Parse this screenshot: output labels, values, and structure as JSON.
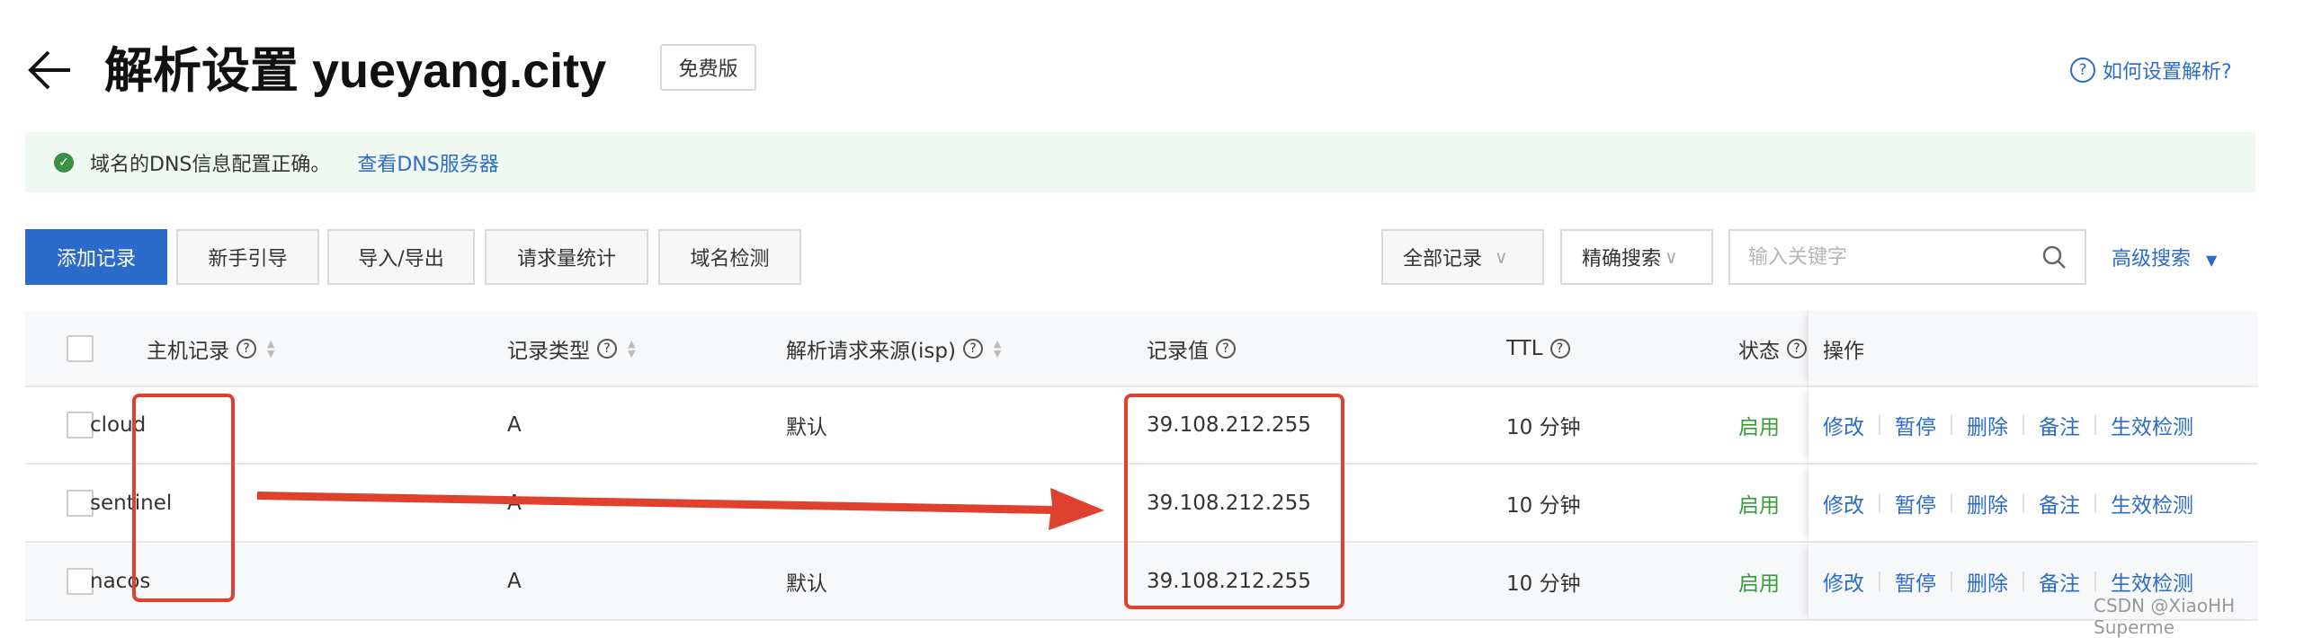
{
  "header": {
    "title": "解析设置 yueyang.city",
    "badge": "免费版",
    "help_link": "如何设置解析?",
    "help_icon": "question-circle-icon",
    "back_icon": "arrow-left-icon"
  },
  "notice": {
    "text": "域名的DNS信息配置正确。",
    "link": "查看DNS服务器",
    "icon": "check-circle-icon"
  },
  "toolbar": {
    "buttons": [
      "添加记录",
      "新手引导",
      "导入/导出",
      "请求量统计",
      "域名检测"
    ],
    "filter_select": "全部记录",
    "search_mode_select": "精确搜索",
    "search_placeholder": "输入关键字",
    "advanced_search": "高级搜索"
  },
  "table": {
    "columns": [
      "主机记录",
      "记录类型",
      "解析请求来源(isp)",
      "记录值",
      "TTL",
      "状态",
      "操作"
    ],
    "rows": [
      {
        "host": "cloud",
        "type": "A",
        "isp": "默认",
        "value": "39.108.212.255",
        "ttl": "10 分钟",
        "status": "启用"
      },
      {
        "host": "sentinel",
        "type": "A",
        "isp": "",
        "value": "39.108.212.255",
        "ttl": "10 分钟",
        "status": "启用"
      },
      {
        "host": "nacos",
        "type": "A",
        "isp": "默认",
        "value": "39.108.212.255",
        "ttl": "10 分钟",
        "status": "启用"
      }
    ],
    "actions": [
      "修改",
      "暂停",
      "删除",
      "备注",
      "生效检测"
    ]
  },
  "colors": {
    "primary": "#2d6bcb",
    "success": "#3a9b3a",
    "annotation": "#e0412f",
    "notice_bg": "#f0f9f1"
  },
  "watermark": "CSDN @XiaoHH Superme"
}
